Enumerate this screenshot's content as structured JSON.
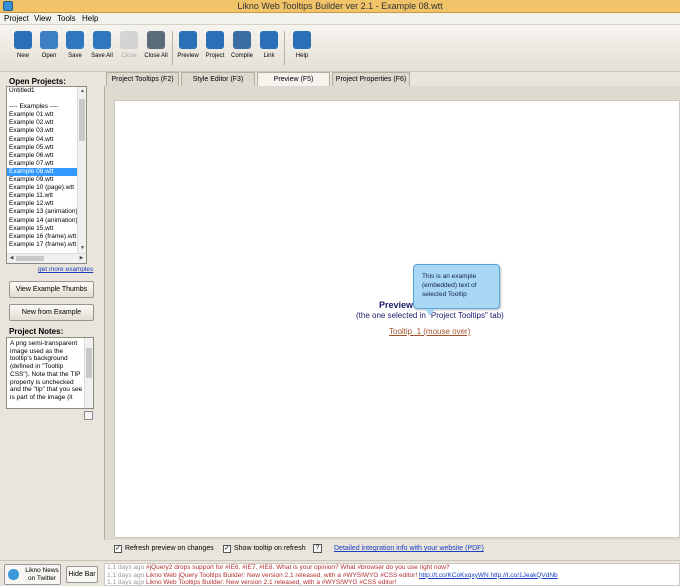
{
  "window": {
    "title": "Likno Web Tooltips Builder ver 2.1 - Example 08.wtt"
  },
  "menu": [
    "Project",
    "View",
    "Tools",
    "Help"
  ],
  "toolbar": {
    "buttons": [
      {
        "label": "New",
        "icon": "new-project-icon",
        "color": "#2a6fb8",
        "enabled": true
      },
      {
        "label": "Open",
        "icon": "open-folder-icon",
        "color": "#3d7fc4",
        "enabled": true
      },
      {
        "label": "Save",
        "icon": "save-icon",
        "color": "#2f78c0",
        "enabled": true
      },
      {
        "label": "Save All",
        "icon": "save-all-icon",
        "color": "#2f78c0",
        "enabled": true
      },
      {
        "label": "Close",
        "icon": "close-icon",
        "color": "#9aa4b0",
        "enabled": false
      },
      {
        "label": "Close All",
        "icon": "close-all-icon",
        "color": "#5b6b7c",
        "enabled": true
      },
      {
        "label": "Preview",
        "icon": "preview-icon",
        "color": "#2a6fb8",
        "enabled": true
      },
      {
        "label": "Project",
        "icon": "project-settings-icon",
        "color": "#2a6fb8",
        "enabled": true
      },
      {
        "label": "Compile",
        "icon": "compile-gear-icon",
        "color": "#3b6ea0",
        "enabled": true
      },
      {
        "label": "Link",
        "icon": "link-globe-icon",
        "color": "#2a6fb8",
        "enabled": true
      },
      {
        "label": "Help",
        "icon": "help-icon",
        "color": "#2a6fb8",
        "enabled": true
      }
    ]
  },
  "left_panel": {
    "open_projects_label": "Open Projects:",
    "projects": [
      "Untitled1",
      "",
      "---- Examples ----",
      "Example 01.wtt",
      "Example 02.wtt",
      "Example 03.wtt",
      "Example 04.wtt",
      "Example 05.wtt",
      "Example 06.wtt",
      "Example 07.wtt",
      "Example 08.wtt",
      "Example 09.wtt",
      "Example 10 (page).wtt",
      "Example 11.wtt",
      "Example 12.wtt",
      "Example 13 (animation).wtt",
      "Example 14 (animation).wtt",
      "Example 15.wtt",
      "Example 16 (frame).wtt",
      "Example 17 (frame).wtt"
    ],
    "selected_project": "Example 08.wtt",
    "get_more_link": "get more examples",
    "view_thumbs_button": "View Example Thumbs",
    "new_from_example_button": "New from Example",
    "project_notes_label": "Project Notes:",
    "project_notes": "A png semi-transparent image used as the tooltip's background (defined in \"Tooltip CSS\"). Note that the TIP property is unchecked and the \"tip\" that you see is part of the image (it"
  },
  "tabs": [
    {
      "label": "Project Tooltips   (F2)",
      "active": false
    },
    {
      "label": "Style Editor   (F3)",
      "active": false
    },
    {
      "label": "Preview   (F5)",
      "active": true
    },
    {
      "label": "Project Properties   (F6)",
      "active": false
    }
  ],
  "preview": {
    "heading": "Preview o",
    "subheading": "(the one selected in \"Project Tooltips\" tab)",
    "tooltip_link": "Tooltip_1 (mouse over)",
    "tooltip_text": "This is an example (embedded) text of selected Tooltip",
    "tooltip_color": "#a9d8f5"
  },
  "options": {
    "refresh_preview_label": "Refresh preview on changes",
    "refresh_preview_checked": true,
    "show_tooltip_label": "Show tooltip on refresh",
    "show_tooltip_checked": true,
    "help_label": "?",
    "integration_link": "Detailed integration info with your website (PDF)"
  },
  "newsbar": {
    "twitter_button": "Likno News on Twitter",
    "hide_bar_button": "Hide Bar",
    "items": [
      {
        "ago": "1.1 days ago",
        "text": "#jQuery2 drops support for #IE6, #IE7, #IE8. What is your opinion? What #browser do you use right now?",
        "link": ""
      },
      {
        "ago": "1.1 days ago",
        "text": "Likno Web jQuery Tooltips Builder: New version 2.1 released, with a #WYSIWYG #CSS editor!",
        "link": "http://t.co/KCoKxqxyWN  http://t.co/1JeakQVdNb"
      },
      {
        "ago": "1.1 days ago",
        "text": "Likno Web Tooltips Builder: New version 2.1 released, with a #WYSIWYG #CSS editor!",
        "link": ""
      }
    ]
  }
}
